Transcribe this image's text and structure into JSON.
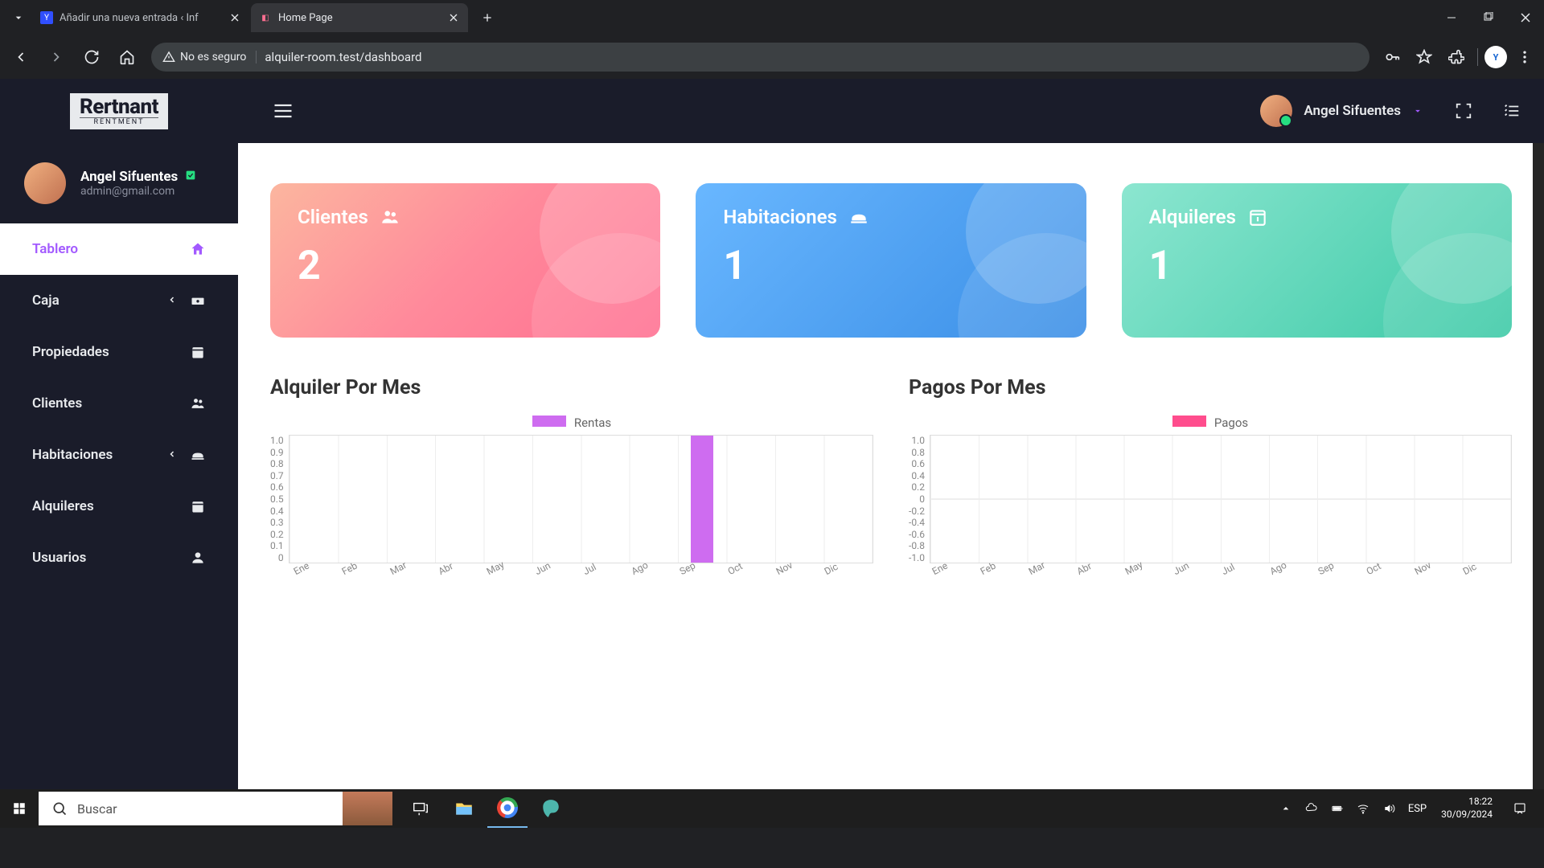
{
  "browser": {
    "tabs": [
      {
        "title": "Añadir una nueva entrada ‹ Inf",
        "favicon_text": "Y",
        "favicon_bg": "#304ffe",
        "favicon_color": "#fff"
      },
      {
        "title": "Home Page",
        "favicon_text": "◧",
        "favicon_bg": "transparent",
        "favicon_color": "#ff6f91"
      }
    ],
    "security_label": "No es seguro",
    "url": "alquiler-room.test/dashboard"
  },
  "logo": {
    "main": "Rertnant",
    "sub": "RENTMENT"
  },
  "user": {
    "name": "Angel Sifuentes",
    "email": "admin@gmail.com"
  },
  "nav": [
    {
      "label": "Tablero",
      "icon": "home",
      "active": true
    },
    {
      "label": "Caja",
      "icon": "cash",
      "expandable": true
    },
    {
      "label": "Propiedades",
      "icon": "calendar"
    },
    {
      "label": "Clientes",
      "icon": "group"
    },
    {
      "label": "Habitaciones",
      "icon": "bed",
      "expandable": true
    },
    {
      "label": "Alquileres",
      "icon": "calendar"
    },
    {
      "label": "Usuarios",
      "icon": "person"
    }
  ],
  "cards": [
    {
      "title": "Clientes",
      "value": "2",
      "icon": "group"
    },
    {
      "title": "Habitaciones",
      "value": "1",
      "icon": "bed"
    },
    {
      "title": "Alquileres",
      "value": "1",
      "icon": "calendar"
    }
  ],
  "charts": {
    "left": {
      "title": "Alquiler Por Mes",
      "legend": "Rentas"
    },
    "right": {
      "title": "Pagos Por Mes",
      "legend": "Pagos"
    }
  },
  "chart_data": [
    {
      "type": "bar",
      "title": "Alquiler Por Mes",
      "series": [
        {
          "name": "Rentas",
          "values": [
            0,
            0,
            0,
            0,
            0,
            0,
            0,
            0,
            1,
            0,
            0,
            0
          ]
        }
      ],
      "categories": [
        "Ene",
        "Feb",
        "Mar",
        "Abr",
        "May",
        "Jun",
        "Jul",
        "Ago",
        "Sep",
        "Oct",
        "Nov",
        "Dic"
      ],
      "ylim": [
        0,
        1
      ],
      "yticks": [
        1.0,
        0.9,
        0.8,
        0.7,
        0.6,
        0.5,
        0.4,
        0.3,
        0.2,
        0.1,
        0
      ],
      "xlabel": "",
      "ylabel": ""
    },
    {
      "type": "bar",
      "title": "Pagos Por Mes",
      "series": [
        {
          "name": "Pagos",
          "values": [
            0,
            0,
            0,
            0,
            0,
            0,
            0,
            0,
            0,
            0,
            0,
            0
          ]
        }
      ],
      "categories": [
        "Ene",
        "Feb",
        "Mar",
        "Abr",
        "May",
        "Jun",
        "Jul",
        "Ago",
        "Sep",
        "Oct",
        "Nov",
        "Dic"
      ],
      "ylim": [
        -1,
        1
      ],
      "yticks": [
        1.0,
        0.8,
        0.6,
        0.4,
        0.2,
        0,
        -0.2,
        -0.4,
        -0.6,
        -0.8,
        -1.0
      ],
      "xlabel": "",
      "ylabel": ""
    }
  ],
  "taskbar": {
    "search_placeholder": "Buscar",
    "lang": "ESP",
    "time": "18:22",
    "date": "30/09/2024"
  }
}
